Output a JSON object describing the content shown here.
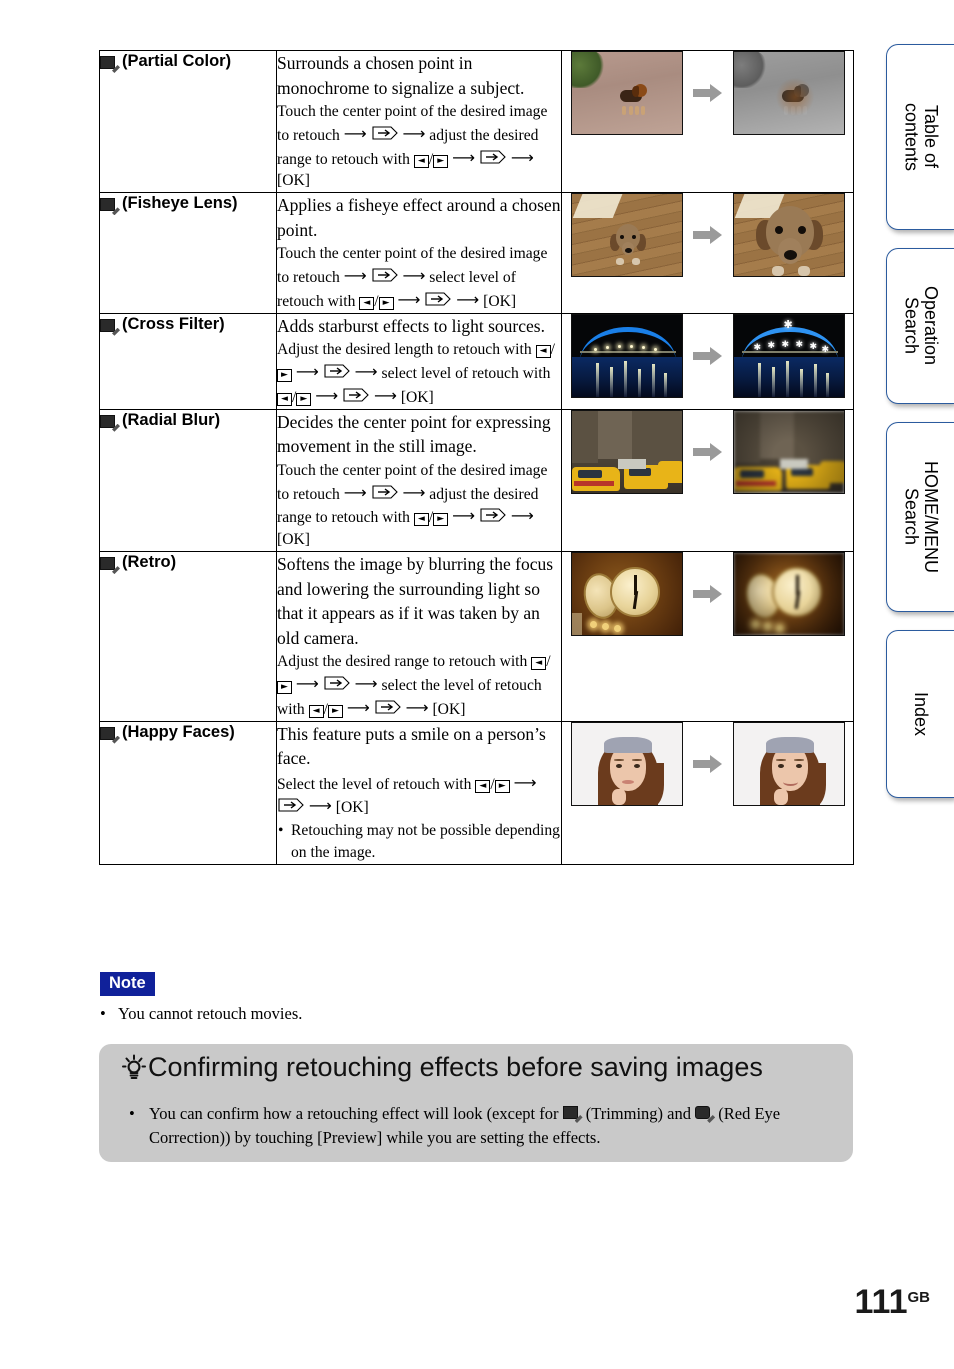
{
  "page": {
    "number": "111",
    "region_suffix": "GB"
  },
  "side_tabs": [
    {
      "name": "table-of-contents",
      "label": "Table of\ncontents"
    },
    {
      "name": "operation-search",
      "label": "Operation\nSearch"
    },
    {
      "name": "home-menu-search",
      "label": "HOME/MENU\nSearch"
    },
    {
      "name": "index",
      "label": "Index"
    }
  ],
  "table": {
    "rows": [
      {
        "icon": "partial-color-icon",
        "name": "(Partial Color)",
        "desc_main": "Surrounds a chosen point in monochrome to signalize a subject.",
        "desc_steps": [
          "Touch the center point of the desired image to retouch",
          "adjust the desired range to retouch with",
          "[OK]"
        ],
        "image_before": "puppy on brick path, color",
        "image_after": "puppy on brick path, monochrome surround"
      },
      {
        "icon": "fisheye-lens-icon",
        "name": "(Fisheye Lens)",
        "desc_main": "Applies a fisheye effect around a chosen point.",
        "desc_steps": [
          "Touch the center point of the desired image to retouch",
          "select level of retouch with",
          "[OK]"
        ],
        "image_before": "dachshund on wooden deck, normal",
        "image_after": "dachshund on wooden deck, fisheye distorted"
      },
      {
        "icon": "cross-filter-icon",
        "name": "(Cross Filter)",
        "desc_main": "Adds starburst effects to light sources.",
        "desc_steps": [
          "Adjust the desired length to retouch with",
          "select level of retouch with",
          "[OK]"
        ],
        "image_before": "illuminated blue bridge at night",
        "image_after": "illuminated blue bridge at night with starbursts"
      },
      {
        "icon": "radial-blur-icon",
        "name": "(Radial Blur)",
        "desc_main": "Decides the center point for expressing movement in the still image.",
        "desc_steps": [
          "Touch the center point of the desired image to retouch",
          "adjust the desired range to retouch with",
          "[OK]"
        ],
        "image_before": "yellow taxis on city street",
        "image_after": "yellow taxis with radial blur"
      },
      {
        "icon": "retro-icon",
        "name": "(Retro)",
        "desc_main": "Softens the image by blurring the focus and lowering the surrounding light so that it appears as if it was taken by an old camera.",
        "desc_steps": [
          "Adjust the desired range to retouch with",
          "select the level of retouch with",
          "[OK]"
        ],
        "image_before": "antique station clock",
        "image_after": "antique station clock, retro softened"
      },
      {
        "icon": "happy-faces-icon",
        "name": "(Happy Faces)",
        "desc_main": "This feature puts a smile on a person’s face.",
        "desc_steps": [
          "Select the level of retouch with",
          "[OK]"
        ],
        "desc_note": "Retouching may not be possible depending on the image.",
        "image_before": "woman with headband, neutral expression",
        "image_after": "woman with headband, smiling"
      }
    ]
  },
  "note": {
    "badge": "Note",
    "items": [
      "You cannot retouch movies."
    ]
  },
  "tip": {
    "title": "Confirming retouching effects before saving images",
    "body_part1": "You can confirm how a retouching effect will look (except for",
    "trimming_label": "(Trimming) and",
    "redeye_label": "(Red Eye Correction)) by touching [Preview] while you are setting the effects."
  },
  "glyph_labels": {
    "left_key": "◀",
    "right_key": "▶",
    "ok": "[OK]"
  },
  "colors": {
    "note_badge_bg": "#10219a",
    "tip_bg": "#c9c9c9",
    "tab_border": "#2b5b9e"
  }
}
